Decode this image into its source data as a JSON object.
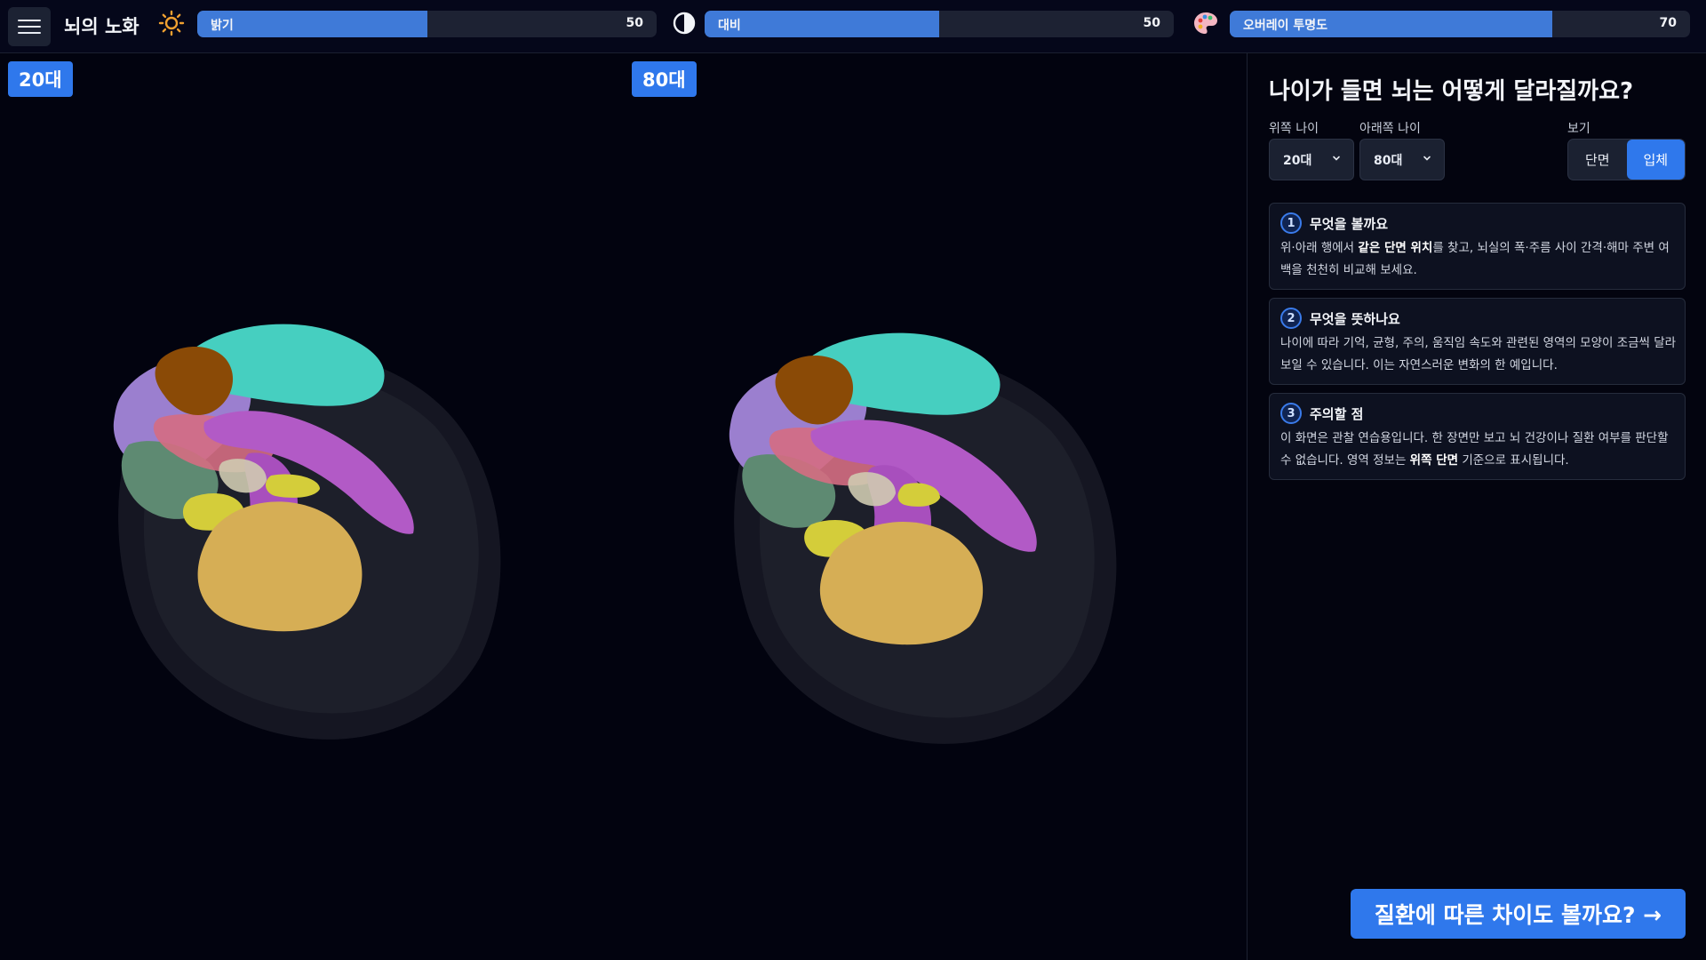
{
  "header": {
    "menu_icon": "hamburger-icon",
    "title": "뇌의 노화",
    "sliders": [
      {
        "icon": "sun-icon",
        "label": "밝기",
        "value": "50",
        "percent": 50
      },
      {
        "icon": "contrast-icon",
        "label": "대비",
        "value": "50",
        "percent": 50
      },
      {
        "icon": "palette-icon",
        "label": "오버레이 투명도",
        "value": "70",
        "percent": 70
      }
    ]
  },
  "viewports": {
    "left_badge": "20대",
    "right_badge": "80대"
  },
  "panel": {
    "title": "나이가 들면 뇌는 어떻게 달라질까요?",
    "upper_age_label": "위쪽 나이",
    "upper_age_value": "20대",
    "lower_age_label": "아래쪽 나이",
    "lower_age_value": "80대",
    "view_label": "보기",
    "view_options": [
      "단면",
      "입체"
    ],
    "view_selected": "입체",
    "cards": [
      {
        "number": "1",
        "title": "무엇을 볼까요",
        "body_parts": [
          "위·아래 행에서 ",
          "같은 단면 위치",
          "를 찾고, 뇌실의 폭·주름 사이 간격·해마 주변 여백을 천천히 비교해 보세요."
        ]
      },
      {
        "number": "2",
        "title": "무엇을 뜻하나요",
        "body": "나이에 따라 기억, 균형, 주의, 움직임 속도와 관련된 영역의 모양이 조금씩 달라 보일 수 있습니다. 이는 자연스러운 변화의 한 예입니다."
      },
      {
        "number": "3",
        "title": "주의할 점",
        "body_parts": [
          "이 화면은 관찰 연습용입니다. 한 장면만 보고 뇌 건강이나 질환 여부를 판단할 수 없습니다. 영역 정보는 ",
          "위쪽 단면",
          " 기준으로 표시됩니다."
        ]
      }
    ],
    "cta_label": "질환에 따른 차이도 볼까요? →"
  },
  "colors": {
    "accent": "#2f78ec",
    "slider_fill": "#3f7ad8",
    "background": "#02030f",
    "brain_frontal": "#9b7fcf",
    "brain_parietal": "#46cfc0",
    "brain_thalamus": "#8a4a06",
    "brain_cingulate": "#b25ac6",
    "brain_temporal": "#5e8a72",
    "brain_cerebellum": "#d6ae55",
    "brain_brainstem": "#d4cd3a",
    "brain_insula": "#d56d82",
    "brain_envelope": "#3a3c48"
  }
}
